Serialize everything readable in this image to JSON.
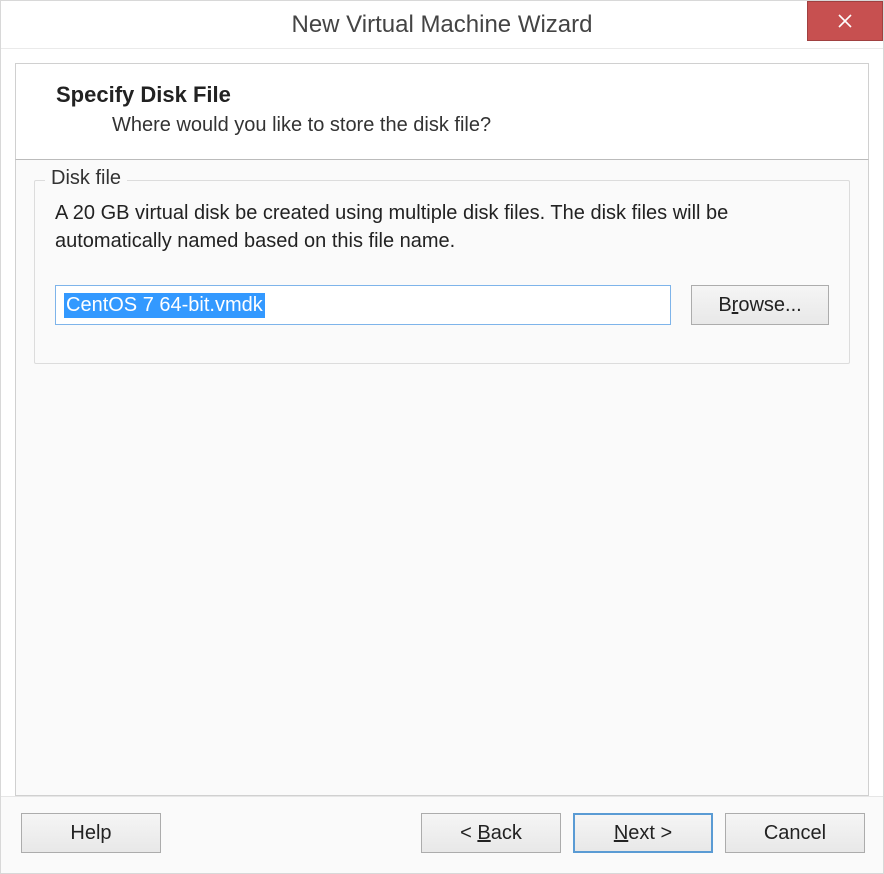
{
  "window": {
    "title": "New Virtual Machine Wizard"
  },
  "header": {
    "title": "Specify Disk File",
    "subtitle": "Where would you like to store the disk file?"
  },
  "fieldset": {
    "legend": "Disk file",
    "description": "A 20 GB virtual disk be created using multiple disk files. The disk files will be automatically named based on this file name.",
    "file_value": "CentOS 7 64-bit.vmdk",
    "browse_label_pre": "B",
    "browse_label_mnemonic": "r",
    "browse_label_post": "owse..."
  },
  "footer": {
    "help": "Help",
    "back_pre": "< ",
    "back_mnemonic": "B",
    "back_post": "ack",
    "next_mnemonic": "N",
    "next_post": "ext >",
    "cancel": "Cancel"
  }
}
